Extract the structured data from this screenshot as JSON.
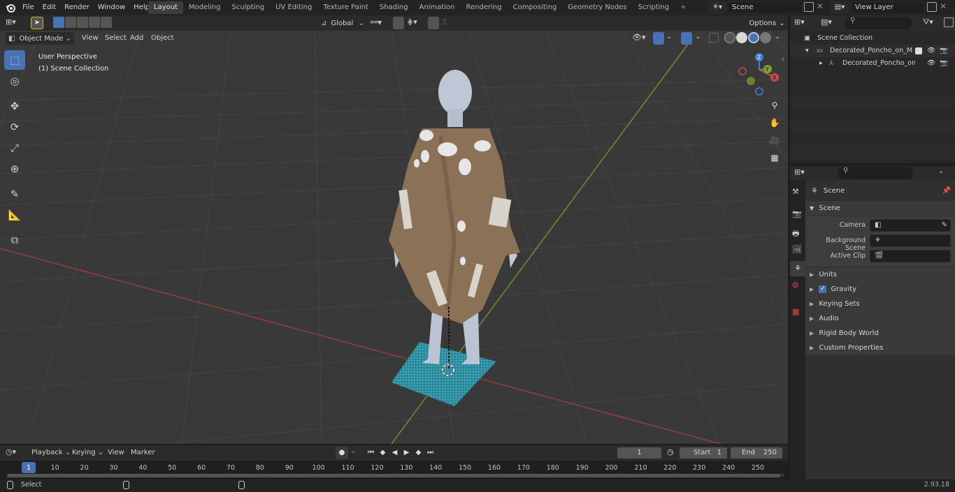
{
  "menu": [
    "File",
    "Edit",
    "Render",
    "Window",
    "Help"
  ],
  "workspaces": [
    "Layout",
    "Modeling",
    "Sculpting",
    "UV Editing",
    "Texture Paint",
    "Shading",
    "Animation",
    "Rendering",
    "Compositing",
    "Geometry Nodes",
    "Scripting"
  ],
  "active_workspace": "Layout",
  "scene_name": "Scene",
  "view_layer": "View Layer",
  "header": {
    "transform_orientation": "Global",
    "options": "Options",
    "mode": "Object Mode",
    "view": "View",
    "select": "Select",
    "add": "Add",
    "object": "Object"
  },
  "viewport": {
    "perspective": "User Perspective",
    "collection": "(1) Scene Collection",
    "gizmo_axes": [
      "Z",
      "Y",
      "X"
    ]
  },
  "outliner": {
    "root": "Scene Collection",
    "collection": "Decorated_Poncho_on_Manne",
    "object": "Decorated_Poncho_on_M"
  },
  "properties": {
    "context": "Scene",
    "panel": "Scene",
    "fields": [
      {
        "label": "Camera",
        "value": ""
      },
      {
        "label": "Background Scene",
        "value": ""
      },
      {
        "label": "Active Clip",
        "value": ""
      }
    ],
    "subpanels": [
      "Units",
      "Gravity",
      "Keying Sets",
      "Audio",
      "Rigid Body World",
      "Custom Properties"
    ],
    "gravity_checked": true
  },
  "timeline": {
    "playback": "Playback",
    "keying": "Keying",
    "view": "View",
    "marker": "Marker",
    "current_frame": "1",
    "start_label": "Start",
    "start": "1",
    "end_label": "End",
    "end": "250",
    "ruler": [
      "1",
      "10",
      "20",
      "30",
      "40",
      "50",
      "60",
      "70",
      "80",
      "90",
      "100",
      "110",
      "120",
      "130",
      "140",
      "150",
      "160",
      "170",
      "180",
      "190",
      "200",
      "210",
      "220",
      "230",
      "240",
      "250"
    ]
  },
  "status": {
    "select": "Select",
    "version": "2.93.18"
  },
  "colors": {
    "accent": "#4772b3",
    "x_axis": "#c84a4a",
    "y_axis": "#7ea32c",
    "z_axis": "#3f7fd8",
    "poncho": "#8b7256",
    "mannequin": "#bfc7d6",
    "rug": "#2f8fa0"
  }
}
